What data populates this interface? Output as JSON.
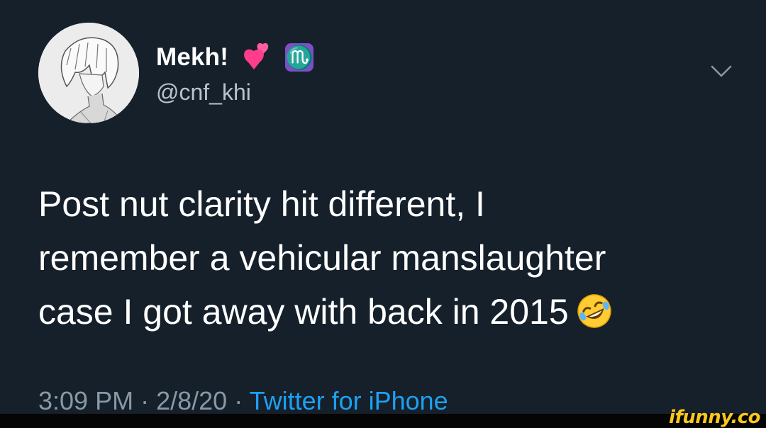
{
  "tweet": {
    "display_name": "Mekh!",
    "emoji_heart": "💕",
    "zodiac": "♏",
    "handle": "@cnf_khi",
    "text_lines": [
      "Post nut clarity hit different, I",
      "remember a vehicular manslaughter",
      "case I got away with back in 2015"
    ],
    "emoji_end": "rofl-emoji",
    "time": "3:09 PM",
    "separator": "·",
    "date": "2/8/20",
    "source": "Twitter for iPhone"
  },
  "watermark": "ifunny.co",
  "icons": {
    "chevron": "chevron-down-icon"
  },
  "colors": {
    "background": "#15202b",
    "accent": "#1da1f2",
    "muted": "#8899a6",
    "watermark": "#f8c81c"
  }
}
